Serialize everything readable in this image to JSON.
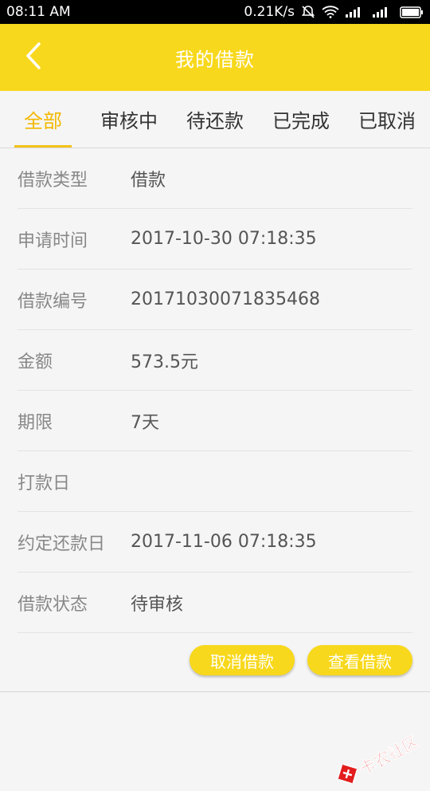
{
  "status_bar": {
    "time": "08:11 AM",
    "network_speed": "0.21K/s"
  },
  "header": {
    "title": "我的借款"
  },
  "tabs": [
    {
      "label": "全部",
      "active": true
    },
    {
      "label": "审核中",
      "active": false
    },
    {
      "label": "待还款",
      "active": false
    },
    {
      "label": "已完成",
      "active": false
    },
    {
      "label": "已取消",
      "active": false
    }
  ],
  "details": [
    {
      "label": "借款类型",
      "value": "借款"
    },
    {
      "label": "申请时间",
      "value": "2017-10-30 07:18:35"
    },
    {
      "label": "借款编号",
      "value": "20171030071835468"
    },
    {
      "label": "金额",
      "value": "573.5元"
    },
    {
      "label": "期限",
      "value": "7天"
    },
    {
      "label": "打款日",
      "value": ""
    },
    {
      "label": "约定还款日",
      "value": "2017-11-06 07:18:35"
    },
    {
      "label": "借款状态",
      "value": "待审核"
    }
  ],
  "actions": {
    "cancel_label": "取消借款",
    "view_label": "查看借款"
  },
  "watermark": {
    "text": "卡农社区"
  },
  "colors": {
    "brand": "#f8d81c",
    "active_tab": "#f3b800",
    "watermark": "#e21d1d"
  }
}
